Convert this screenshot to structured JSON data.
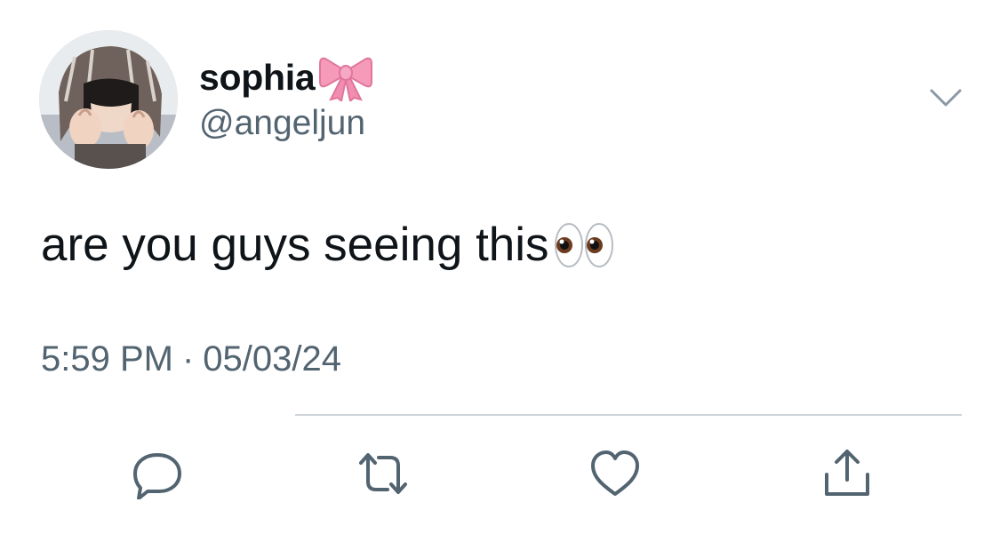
{
  "user": {
    "display_name": "sophia",
    "handle": "@angeljun",
    "avatar_icon": "profile-photo",
    "badge_emoji_icon": "pink-ribbon-icon"
  },
  "tweet": {
    "text": "are you guys seeing this",
    "trailing_emoji_icon": "eyes-emoji-icon",
    "time": "5:59 PM",
    "separator": "·",
    "date": "05/03/24"
  },
  "actions": {
    "reply_icon": "reply-icon",
    "retweet_icon": "retweet-icon",
    "like_icon": "heart-icon",
    "share_icon": "share-icon",
    "more_icon": "chevron-down-icon"
  },
  "colors": {
    "text_primary": "#0f1419",
    "text_secondary": "#536471",
    "icon": "#536471",
    "ribbon": "#f28cb1",
    "divider": "#cfd4d9"
  }
}
